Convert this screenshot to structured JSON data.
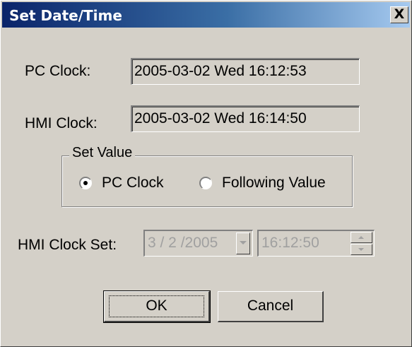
{
  "window": {
    "title": "Set Date/Time",
    "close_label": "X"
  },
  "pc_clock": {
    "label": "PC Clock:",
    "value": "2005-03-02 Wed 16:12:53"
  },
  "hmi_clock": {
    "label": "HMI Clock:",
    "value": "2005-03-02 Wed 16:14:50"
  },
  "set_value": {
    "legend": "Set Value",
    "options": [
      {
        "label": "PC Clock",
        "selected": true
      },
      {
        "label": "Following Value",
        "selected": false
      }
    ]
  },
  "hmi_clock_set": {
    "label": "HMI Clock Set:",
    "date": "3 / 2 /2005",
    "time": "16:12:50"
  },
  "buttons": {
    "ok": "OK",
    "cancel": "Cancel"
  },
  "colors": {
    "title_start": "#0a246a",
    "title_end": "#a6caf0",
    "face": "#d4d0c8",
    "disabled_text": "#a0a0a0"
  }
}
